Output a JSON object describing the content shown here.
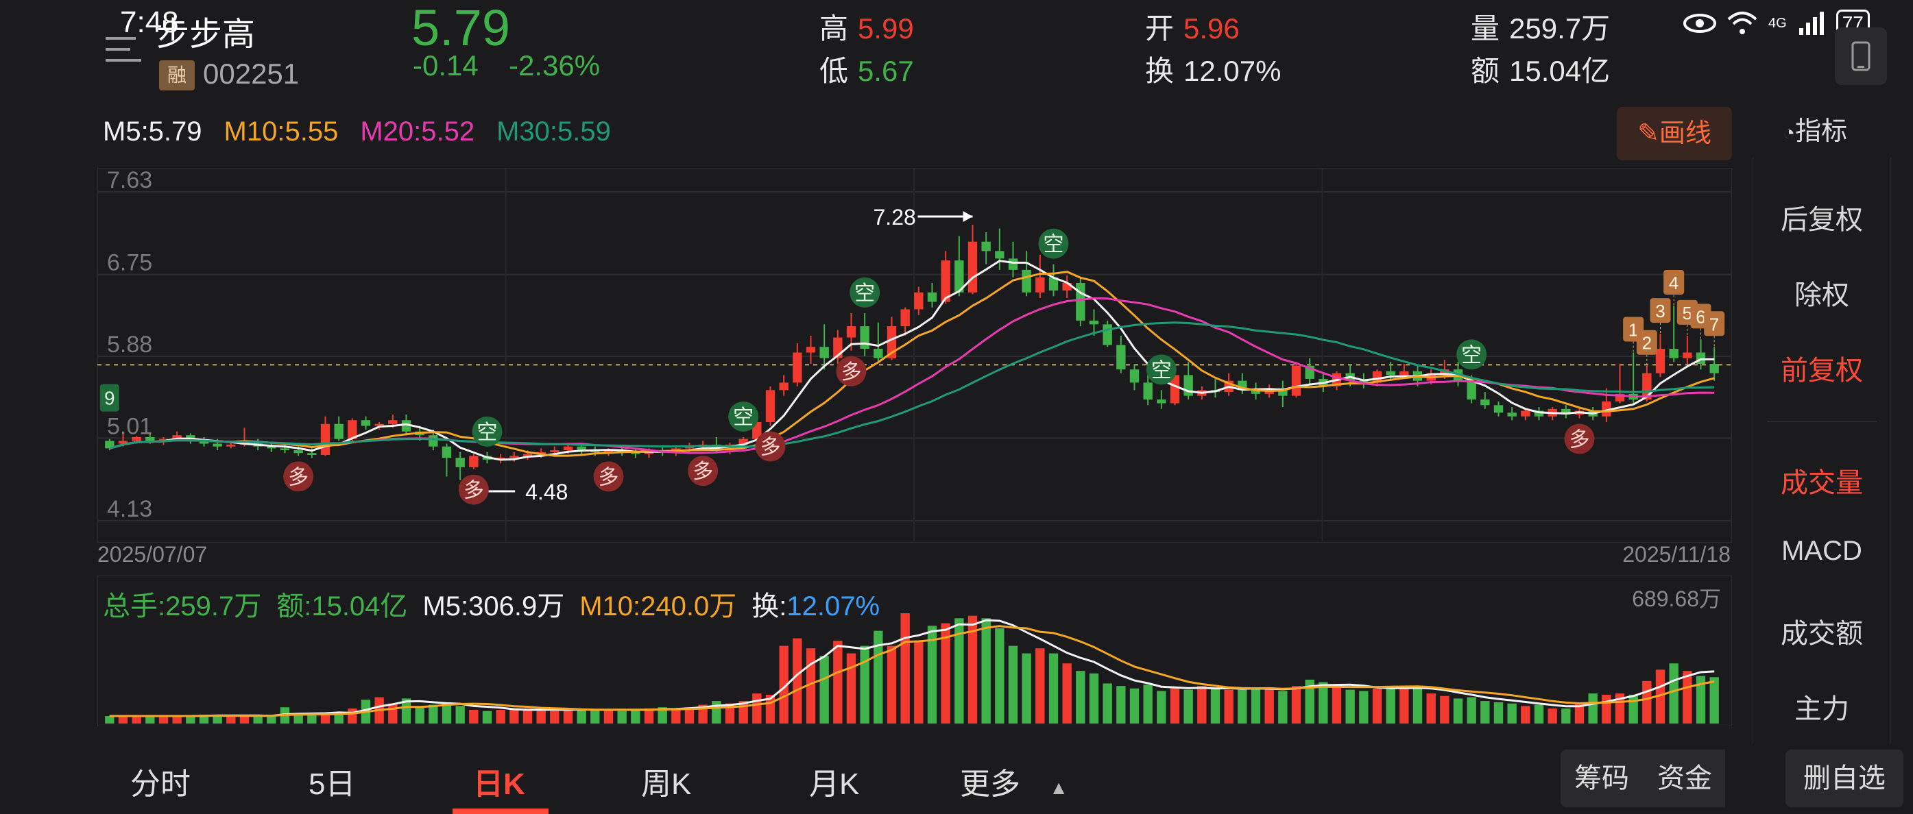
{
  "status": {
    "time": "7:48",
    "battery": "77",
    "network": "4G"
  },
  "stock": {
    "name": "步步高",
    "margin_badge": "融",
    "code": "002251",
    "price": "5.79",
    "change": "-0.14",
    "change_pct": "-2.36%"
  },
  "stats": {
    "high_label": "高",
    "high": "5.99",
    "low_label": "低",
    "low": "5.67",
    "open_label": "开",
    "open": "5.96",
    "turnover_label": "换",
    "turnover": "12.07%",
    "volume_label": "量",
    "volume": "259.7万",
    "amount_label": "额",
    "amount": "15.04亿"
  },
  "ma_legend": {
    "m5": "M5:5.79",
    "m10": "M10:5.55",
    "m20": "M20:5.52",
    "m30": "M30:5.59"
  },
  "draw_button": "画线",
  "indicator_button": "指标",
  "vol_legend": {
    "total": "总手:259.7万",
    "amount": "额:15.04亿",
    "m5": "M5:306.9万",
    "m10": "M10:240.0万",
    "turn_label": "换:",
    "turn": "12.07%"
  },
  "colors": {
    "up": "#f23b2e",
    "down": "#3fb24a",
    "m5": "#f2f2f2",
    "m10": "#f5a623",
    "m20": "#e83ab0",
    "m30": "#1e9a78",
    "accent": "#ff4a3a"
  },
  "right_panel": [
    "后复权",
    "除权",
    "前复权",
    "成交量",
    "MACD",
    "成交额",
    "主力"
  ],
  "bottom_tabs": [
    "分时",
    "5日",
    "日K",
    "周K",
    "月K",
    "更多"
  ],
  "side_buttons": [
    "筹码",
    "资金",
    "删自选"
  ],
  "chart_data": {
    "type": "candlestick",
    "y_ticks": [
      "7.63",
      "6.75",
      "5.88",
      "5.01",
      "4.13"
    ],
    "ylim": [
      4.13,
      7.63
    ],
    "current_price_line": 5.79,
    "x_start": "2025/07/07",
    "x_end": "2025/11/18",
    "high_annotation": "7.28",
    "low_annotation": "4.48",
    "nine_signal": "9",
    "signals_kong": [
      "空",
      "空",
      "空",
      "空",
      "空",
      "空"
    ],
    "signals_duo": [
      "多",
      "多",
      "多",
      "多",
      "多",
      "多",
      "多"
    ],
    "counter_labels": [
      "1",
      "2",
      "3",
      "4",
      "5",
      "6",
      "7"
    ],
    "volume_max_label": "689.68万",
    "candles": [
      [
        4.98,
        5.0,
        4.9,
        4.88
      ],
      [
        4.95,
        5.05,
        4.98,
        4.92
      ],
      [
        4.98,
        5.03,
        5.02,
        4.95
      ],
      [
        5.02,
        5.06,
        4.98,
        4.95
      ],
      [
        4.98,
        5.02,
        5.0,
        4.94
      ],
      [
        5.0,
        5.08,
        5.04,
        4.98
      ],
      [
        5.04,
        5.06,
        4.98,
        4.95
      ],
      [
        4.98,
        5.02,
        4.95,
        4.92
      ],
      [
        4.95,
        5.0,
        4.92,
        4.88
      ],
      [
        4.92,
        4.96,
        4.94,
        4.9
      ],
      [
        4.94,
        5.12,
        4.96,
        4.92
      ],
      [
        4.96,
        5.0,
        4.92,
        4.88
      ],
      [
        4.92,
        4.95,
        4.9,
        4.86
      ],
      [
        4.9,
        4.94,
        4.88,
        4.85
      ],
      [
        4.88,
        4.92,
        4.85,
        4.82
      ],
      [
        4.85,
        4.9,
        4.83,
        4.8
      ],
      [
        4.83,
        5.24,
        5.16,
        4.82
      ],
      [
        5.16,
        5.24,
        5.0,
        4.98
      ],
      [
        5.0,
        5.22,
        5.2,
        4.98
      ],
      [
        5.2,
        5.24,
        5.14,
        5.1
      ],
      [
        5.14,
        5.18,
        5.16,
        5.1
      ],
      [
        5.16,
        5.26,
        5.2,
        5.12
      ],
      [
        5.2,
        5.26,
        5.08,
        5.04
      ],
      [
        5.08,
        5.14,
        5.04,
        4.98
      ],
      [
        5.04,
        5.1,
        4.92,
        4.88
      ],
      [
        4.92,
        4.95,
        4.8,
        4.6
      ],
      [
        4.8,
        4.86,
        4.7,
        4.56
      ],
      [
        4.7,
        4.84,
        4.82,
        4.68
      ],
      [
        4.82,
        4.86,
        4.78,
        4.74
      ],
      [
        4.78,
        4.84,
        4.8,
        4.74
      ],
      [
        4.8,
        4.86,
        4.82,
        4.76
      ],
      [
        4.82,
        4.88,
        4.84,
        4.78
      ],
      [
        4.84,
        4.9,
        4.86,
        4.8
      ],
      [
        4.86,
        4.92,
        4.88,
        4.82
      ],
      [
        4.88,
        4.96,
        4.92,
        4.84
      ],
      [
        4.92,
        4.96,
        4.88,
        4.84
      ],
      [
        4.88,
        4.92,
        4.86,
        4.82
      ],
      [
        4.86,
        4.9,
        4.88,
        4.82
      ],
      [
        4.88,
        4.92,
        4.86,
        4.82
      ],
      [
        4.86,
        4.9,
        4.84,
        4.8
      ],
      [
        4.84,
        4.9,
        4.88,
        4.8
      ],
      [
        4.88,
        4.92,
        4.86,
        4.82
      ],
      [
        4.86,
        4.92,
        4.9,
        4.82
      ],
      [
        4.9,
        4.96,
        4.92,
        4.86
      ],
      [
        4.92,
        4.98,
        4.94,
        4.88
      ],
      [
        4.94,
        5.02,
        4.9,
        4.86
      ],
      [
        4.88,
        4.96,
        4.94,
        4.84
      ],
      [
        4.94,
        5.02,
        5.0,
        4.9
      ],
      [
        5.0,
        5.2,
        5.18,
        4.98
      ],
      [
        5.18,
        5.56,
        5.52,
        5.14
      ],
      [
        5.52,
        5.68,
        5.6,
        5.46
      ],
      [
        5.6,
        6.02,
        5.92,
        5.56
      ],
      [
        5.92,
        6.1,
        5.98,
        5.8
      ],
      [
        5.98,
        6.22,
        5.86,
        5.74
      ],
      [
        5.86,
        6.16,
        6.08,
        5.8
      ],
      [
        6.08,
        6.34,
        6.2,
        5.94
      ],
      [
        6.2,
        6.34,
        5.96,
        5.88
      ],
      [
        5.96,
        6.24,
        5.86,
        5.82
      ],
      [
        5.86,
        6.3,
        6.2,
        5.84
      ],
      [
        6.2,
        6.4,
        6.38,
        6.1
      ],
      [
        6.38,
        6.62,
        6.56,
        6.32
      ],
      [
        6.56,
        6.66,
        6.46,
        6.4
      ],
      [
        6.46,
        7.0,
        6.9,
        6.44
      ],
      [
        6.9,
        7.16,
        6.56,
        6.52
      ],
      [
        6.56,
        7.28,
        7.1,
        6.54
      ],
      [
        7.1,
        7.2,
        7.0,
        6.86
      ],
      [
        7.0,
        7.24,
        6.92,
        6.8
      ],
      [
        6.92,
        7.1,
        6.8,
        6.72
      ],
      [
        6.8,
        7.0,
        6.56,
        6.52
      ],
      [
        6.56,
        6.96,
        6.72,
        6.5
      ],
      [
        6.72,
        6.86,
        6.58,
        6.52
      ],
      [
        6.58,
        6.74,
        6.66,
        6.5
      ],
      [
        6.66,
        6.72,
        6.26,
        6.2
      ],
      [
        6.26,
        6.38,
        6.22,
        6.1
      ],
      [
        6.22,
        6.26,
        6.0,
        5.98
      ],
      [
        6.0,
        6.1,
        5.74,
        5.7
      ],
      [
        5.74,
        5.8,
        5.6,
        5.52
      ],
      [
        5.6,
        5.68,
        5.42,
        5.36
      ],
      [
        5.42,
        5.52,
        5.38,
        5.32
      ],
      [
        5.38,
        5.76,
        5.68,
        5.36
      ],
      [
        5.68,
        5.82,
        5.46,
        5.42
      ],
      [
        5.46,
        5.56,
        5.52,
        5.42
      ],
      [
        5.52,
        5.64,
        5.5,
        5.44
      ],
      [
        5.5,
        5.7,
        5.62,
        5.46
      ],
      [
        5.62,
        5.7,
        5.52,
        5.48
      ],
      [
        5.52,
        5.6,
        5.48,
        5.42
      ],
      [
        5.48,
        5.58,
        5.54,
        5.44
      ],
      [
        5.54,
        5.62,
        5.46,
        5.34
      ],
      [
        5.46,
        5.82,
        5.78,
        5.44
      ],
      [
        5.78,
        5.86,
        5.64,
        5.58
      ],
      [
        5.64,
        5.7,
        5.56,
        5.5
      ],
      [
        5.56,
        5.72,
        5.7,
        5.52
      ],
      [
        5.7,
        5.8,
        5.62,
        5.56
      ],
      [
        5.62,
        5.7,
        5.6,
        5.54
      ],
      [
        5.6,
        5.74,
        5.72,
        5.56
      ],
      [
        5.72,
        5.82,
        5.68,
        5.62
      ],
      [
        5.68,
        5.8,
        5.72,
        5.64
      ],
      [
        5.72,
        5.78,
        5.62,
        5.56
      ],
      [
        5.62,
        5.74,
        5.7,
        5.58
      ],
      [
        5.7,
        5.84,
        5.74,
        5.64
      ],
      [
        5.74,
        5.82,
        5.62,
        5.56
      ],
      [
        5.62,
        5.68,
        5.42,
        5.38
      ],
      [
        5.42,
        5.5,
        5.36,
        5.32
      ],
      [
        5.36,
        5.4,
        5.28,
        5.24
      ],
      [
        5.28,
        5.34,
        5.24,
        5.2
      ],
      [
        5.24,
        5.32,
        5.3,
        5.2
      ],
      [
        5.3,
        5.34,
        5.24,
        5.2
      ],
      [
        5.24,
        5.34,
        5.32,
        5.2
      ],
      [
        5.32,
        5.36,
        5.26,
        5.22
      ],
      [
        5.26,
        5.34,
        5.3,
        5.22
      ],
      [
        5.3,
        5.34,
        5.24,
        5.2
      ],
      [
        5.24,
        5.54,
        5.4,
        5.18
      ],
      [
        5.4,
        5.8,
        5.48,
        5.38
      ],
      [
        5.48,
        5.92,
        5.42,
        5.38
      ],
      [
        5.42,
        5.78,
        5.7,
        5.4
      ],
      [
        5.7,
        6.12,
        5.96,
        5.66
      ],
      [
        5.96,
        6.42,
        5.86,
        5.82
      ],
      [
        5.86,
        6.1,
        5.92,
        5.8
      ],
      [
        5.92,
        6.06,
        5.8,
        5.74
      ],
      [
        5.8,
        5.98,
        5.7,
        5.62
      ]
    ],
    "volumes": [
      0.06,
      0.06,
      0.06,
      0.06,
      0.06,
      0.06,
      0.06,
      0.07,
      0.07,
      0.06,
      0.06,
      0.06,
      0.06,
      0.13,
      0.08,
      0.07,
      0.07,
      0.09,
      0.12,
      0.19,
      0.21,
      0.16,
      0.2,
      0.13,
      0.15,
      0.17,
      0.14,
      0.11,
      0.1,
      0.11,
      0.11,
      0.12,
      0.11,
      0.1,
      0.11,
      0.12,
      0.11,
      0.11,
      0.1,
      0.11,
      0.12,
      0.13,
      0.12,
      0.13,
      0.15,
      0.18,
      0.16,
      0.18,
      0.24,
      0.23,
      0.62,
      0.68,
      0.6,
      0.54,
      0.66,
      0.56,
      0.62,
      0.74,
      0.62,
      0.88,
      0.66,
      0.78,
      0.8,
      0.84,
      0.86,
      0.84,
      0.76,
      0.62,
      0.56,
      0.6,
      0.56,
      0.48,
      0.42,
      0.4,
      0.32,
      0.3,
      0.28,
      0.31,
      0.26,
      0.29,
      0.27,
      0.3,
      0.28,
      0.27,
      0.27,
      0.28,
      0.29,
      0.26,
      0.3,
      0.35,
      0.33,
      0.3,
      0.27,
      0.26,
      0.28,
      0.3,
      0.3,
      0.28,
      0.24,
      0.22,
      0.2,
      0.21,
      0.18,
      0.17,
      0.16,
      0.14,
      0.15,
      0.12,
      0.12,
      0.16,
      0.24,
      0.23,
      0.24,
      0.23,
      0.34,
      0.43,
      0.48,
      0.42,
      0.38,
      0.37
    ],
    "ma5": [],
    "ma10": [],
    "ma20": [],
    "ma30": []
  }
}
